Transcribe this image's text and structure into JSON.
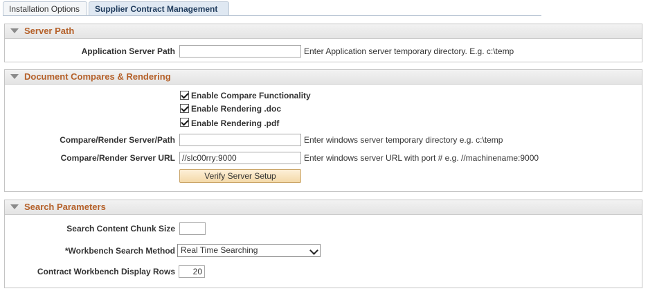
{
  "tabs": [
    {
      "label": "Installation Options",
      "active": false
    },
    {
      "label": "Supplier Contract Management",
      "active": true
    }
  ],
  "server_path": {
    "title": "Server Path",
    "app_server_path_label": "Application Server Path",
    "app_server_path_value": "",
    "app_server_path_hint": "Enter Application server temporary directory. E.g. c:\\temp"
  },
  "doc_compare": {
    "title": "Document Compares & Rendering",
    "checkboxes": [
      {
        "label": "Enable Compare Functionality",
        "checked": true
      },
      {
        "label": "Enable Rendering .doc",
        "checked": true
      },
      {
        "label": "Enable Rendering .pdf",
        "checked": true
      }
    ],
    "render_path_label": "Compare/Render Server/Path",
    "render_path_value": "",
    "render_path_hint": "Enter windows server temporary directory e.g. c:\\temp",
    "render_url_label": "Compare/Render Server URL",
    "render_url_value": "//slc00rry:9000",
    "render_url_hint": "Enter windows server URL with port # e.g. //machinename:9000",
    "verify_button": "Verify Server Setup"
  },
  "search_params": {
    "title": "Search Parameters",
    "chunk_size_label": "Search Content Chunk Size",
    "chunk_size_value": "",
    "search_method_label": "*Workbench Search Method",
    "search_method_value": "Real Time Searching",
    "display_rows_label": "Contract Workbench Display Rows",
    "display_rows_value": "20"
  },
  "colors": {
    "section_title": "#b5612a",
    "button_bg": "#f4d9a8",
    "active_tab_bg": "#dfe8f2"
  },
  "icons": {
    "collapse": "triangle-down-icon",
    "checkbox": "checkmark-icon",
    "dropdown": "chevron-down-icon"
  }
}
